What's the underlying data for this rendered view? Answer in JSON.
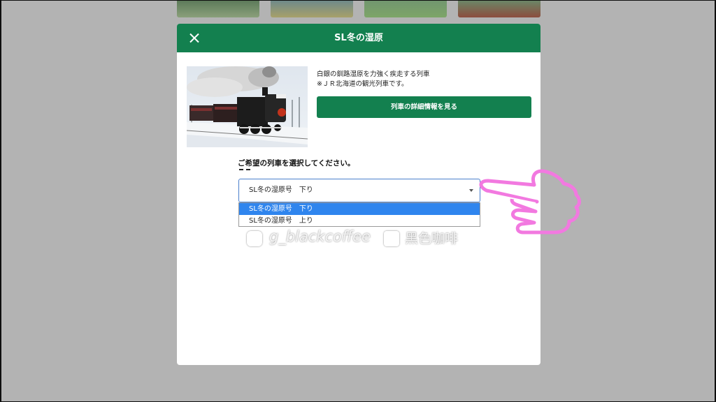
{
  "modal": {
    "title": "SL冬の湿原",
    "description_line1": "白銀の釧路湿原を力強く疾走する列車",
    "description_line2": "※ＪＲ北海道の観光列車です。",
    "detail_button_label": "列車の詳細情報を見る"
  },
  "train_select": {
    "prompt": "ご希望の列車を選択してください。",
    "selected_value": "SL冬の湿原号　下り",
    "options": [
      {
        "label": "SL冬の湿原号　下り",
        "selected": true
      },
      {
        "label": "SL冬の湿原号　上り",
        "selected": false
      }
    ]
  },
  "watermark": {
    "instagram_handle": "g_blackcoffee",
    "facebook_page": "黑色咖啡"
  },
  "colors": {
    "header_green": "#13804f",
    "button_green": "#13804f",
    "highlight_blue": "#2f85ee",
    "overlay_gray": "#b3b3b3",
    "hand_pink": "#f279e0"
  },
  "icons": {
    "close": "close-icon",
    "dropdown": "chevron-down-icon",
    "instagram": "instagram-icon",
    "facebook": "facebook-icon",
    "pointer": "pointing-hand-icon"
  }
}
